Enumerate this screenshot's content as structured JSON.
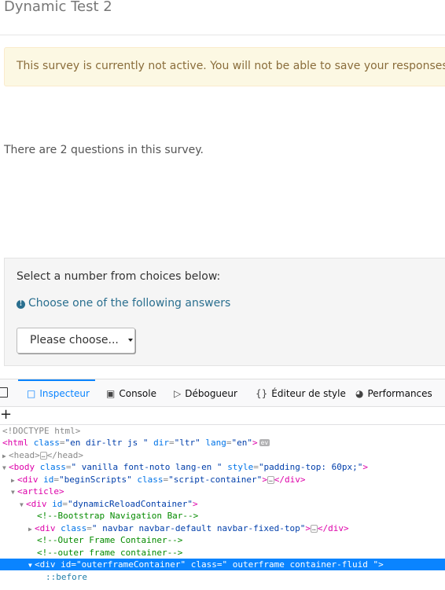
{
  "page": {
    "survey_title": "Dynamic Test 2",
    "alert": "This survey is currently not active. You will not be able to save your responses.",
    "question_count": "There are 2 questions in this survey.",
    "question": {
      "text": "Select a number from choices below:",
      "help_icon": "info-icon",
      "help": "Choose one of the following answers",
      "select_value": "Please choose..."
    }
  },
  "devtools": {
    "tabs": [
      {
        "label": "Inspecteur",
        "icon": "inspector-icon"
      },
      {
        "label": "Console",
        "icon": "console-icon"
      },
      {
        "label": "Débogueur",
        "icon": "debugger-icon"
      },
      {
        "label": "Éditeur de style",
        "icon": "style-editor-icon"
      },
      {
        "label": "Performances",
        "icon": "performance-icon"
      }
    ],
    "add_node": "+",
    "tree": {
      "doctype": "<!DOCTYPE html>",
      "html_tag": "html",
      "html_class_attr": "class",
      "html_class_val": "\"en dir-ltr js \"",
      "html_dir_attr": "dir",
      "html_dir_val": "\"ltr\"",
      "html_lang_attr": "lang",
      "html_lang_val": "\"en\"",
      "html_badge": "ev",
      "head_open": "<head>",
      "head_close": "</head>",
      "body_tag": "body",
      "body_class_attr": "class",
      "body_class_val": "\" vanilla font-noto lang-en \"",
      "body_style_attr": "style",
      "body_style_val": "\"padding-top: 60px;\"",
      "begin_div_tag": "div",
      "begin_id_attr": "id",
      "begin_id_val": "\"beginScripts\"",
      "begin_class_attr": "class",
      "begin_class_val": "\"script-container\"",
      "begin_close": "</div>",
      "article_tag": "article",
      "reload_div_tag": "div",
      "reload_id_attr": "id",
      "reload_id_val": "\"dynamicReloadContainer\"",
      "comment_navbar": "<!--Bootstrap Navigation Bar-->",
      "nav_div_tag": "div",
      "nav_class_attr": "class",
      "nav_class_val": "\" navbar navbar-default navbar-fixed-top\"",
      "nav_close": "</div>",
      "comment_outer1": "<!--Outer Frame Container-->",
      "comment_outer2": "<!--outer frame container-->",
      "outer_div_tag": "div",
      "outer_id_attr": "id",
      "outer_id_val": "\"outerframeContainer\"",
      "outer_class_attr": "class",
      "outer_class_val": "\" outerframe container-fluid \"",
      "pseudo_before": "::before"
    }
  }
}
